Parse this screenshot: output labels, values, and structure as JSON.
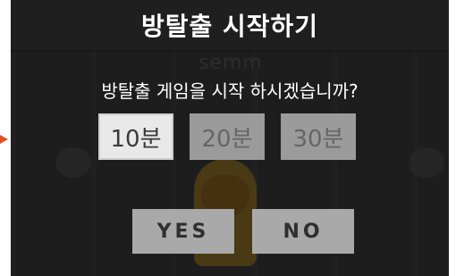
{
  "dialog": {
    "title": "방탈출 시작하기",
    "question": "방탈출 게임을 시작 하시겠습니까?",
    "time_options": [
      {
        "label": "10분",
        "selected": true
      },
      {
        "label": "20분",
        "selected": false
      },
      {
        "label": "30분",
        "selected": false
      }
    ],
    "yes_label": "YES",
    "no_label": "NO"
  },
  "background": {
    "watermark": "semm"
  },
  "colors": {
    "accent_arrow": "#e4511e",
    "selected_bg": "#e9e9e9",
    "unselected_bg": "#9b9b9b",
    "button_bg": "#a9a9a9"
  },
  "icons": [
    "pointer-arrow-icon"
  ]
}
